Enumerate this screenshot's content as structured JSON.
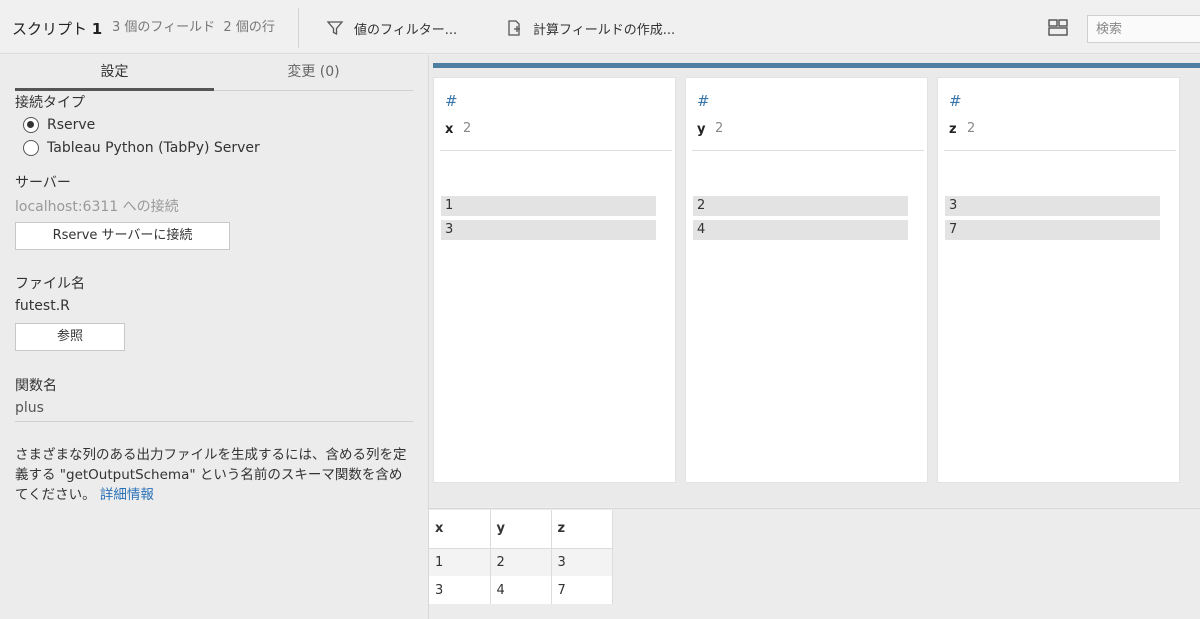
{
  "toolbar": {
    "title_prefix": "スクリプト",
    "title_number": "1",
    "field_count": "3 個のフィールド",
    "row_count": "2 個の行",
    "filter_label": "値のフィルター...",
    "calc_label": "計算フィールドの作成...",
    "search_placeholder": "検索",
    "icons": {
      "filter": "funnel-icon",
      "calc": "calc-field-icon",
      "layout": "layout-toggle-icon"
    }
  },
  "left_panel": {
    "tabs": [
      {
        "label": "設定",
        "active": true
      },
      {
        "label": "変更 (0)",
        "active": false
      }
    ],
    "connection_type_label": "接続タイプ",
    "connection_options": [
      {
        "label": "Rserve",
        "selected": true
      },
      {
        "label": "Tableau Python (TabPy) Server",
        "selected": false
      }
    ],
    "server_label": "サーバー",
    "server_status": "localhost:6311 への接続",
    "connect_button": "Rserve サーバーに接続",
    "file_label": "ファイル名",
    "file_value": "futest.R",
    "browse_button": "参照",
    "function_label": "関数名",
    "function_value": "plus",
    "help_text": "さまざまな列のある出力ファイルを生成するには、含める列を定義する \"getOutputSchema\" という名前のスキーマ関数を含めてください。",
    "help_link": "詳細情報"
  },
  "profile": {
    "cards": [
      {
        "icon": "number-type-icon",
        "type_glyph": "#",
        "name": "x",
        "count": "2",
        "values": [
          "1",
          "3"
        ]
      },
      {
        "icon": "number-type-icon",
        "type_glyph": "#",
        "name": "y",
        "count": "2",
        "values": [
          "2",
          "4"
        ]
      },
      {
        "icon": "number-type-icon",
        "type_glyph": "#",
        "name": "z",
        "count": "2",
        "values": [
          "3",
          "7"
        ]
      }
    ],
    "accent_color": "#4f7ea3"
  },
  "grid": {
    "columns": [
      "x",
      "y",
      "z"
    ],
    "rows": [
      [
        "1",
        "2",
        "3"
      ],
      [
        "3",
        "4",
        "7"
      ]
    ]
  }
}
